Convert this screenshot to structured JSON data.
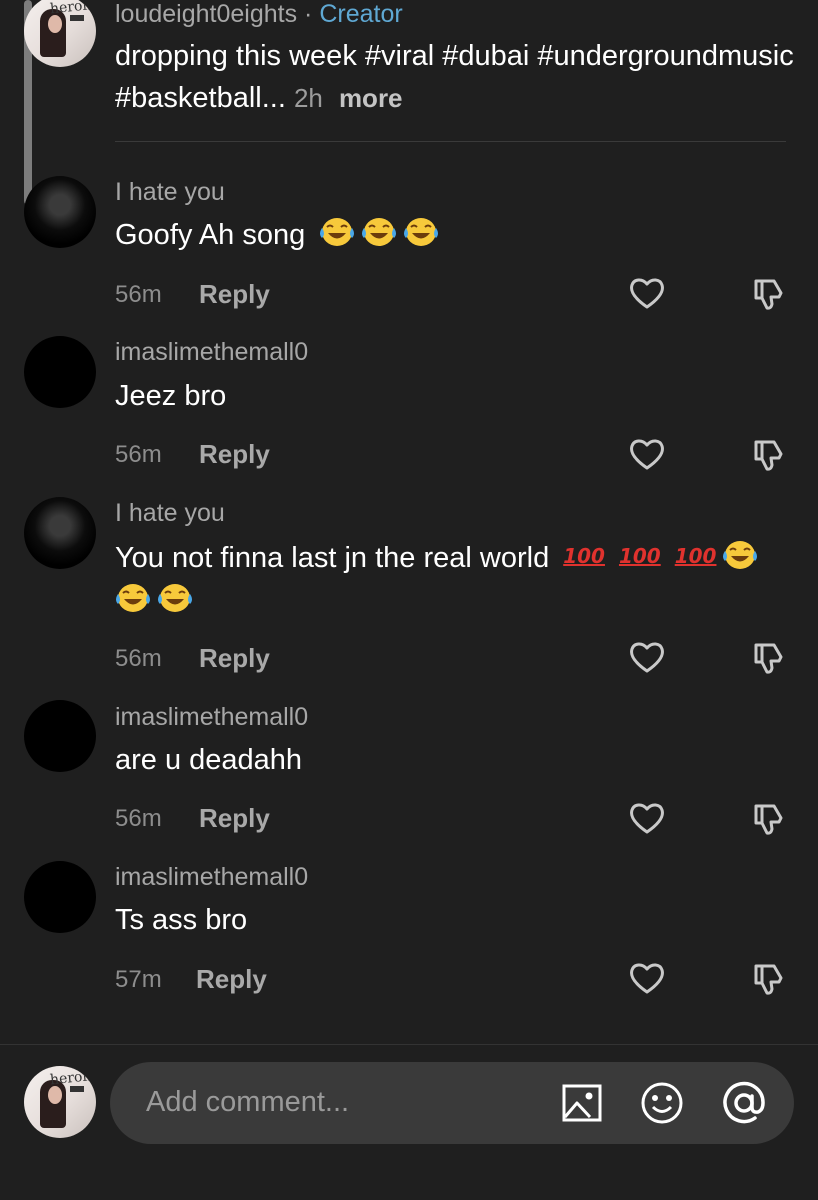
{
  "caption": {
    "author": "loudeight0eights",
    "separator": "·",
    "creator_badge": "Creator",
    "text": "dropping this week #viral #dubai #undergroundmusic #basketball...",
    "time": "2h",
    "more_label": "more",
    "avatar_text": "heroin"
  },
  "comments": [
    {
      "author": "I hate you",
      "text": "Goofy Ah song",
      "time": "56m",
      "reply": "Reply"
    },
    {
      "author": "imaslimethemall0",
      "text": "Jeez bro",
      "time": "56m",
      "reply": "Reply"
    },
    {
      "author": "I hate you",
      "text": "You not finna last jn the real world",
      "hundred": "100",
      "time": "56m",
      "reply": "Reply"
    },
    {
      "author": "imaslimethemall0",
      "text": "are u deadahh",
      "time": "56m",
      "reply": "Reply"
    },
    {
      "author": "imaslimethemall0",
      "text": "Ts ass bro",
      "time": "57m",
      "reply": "Reply"
    }
  ],
  "input": {
    "placeholder": "Add comment...",
    "avatar_text": "heroin"
  },
  "icons": {
    "like": "heart-icon",
    "dislike": "thumbs-down-icon",
    "image": "image-icon",
    "emoji": "smiley-icon",
    "mention": "at-icon",
    "laugh": "tears-of-joy-icon"
  }
}
